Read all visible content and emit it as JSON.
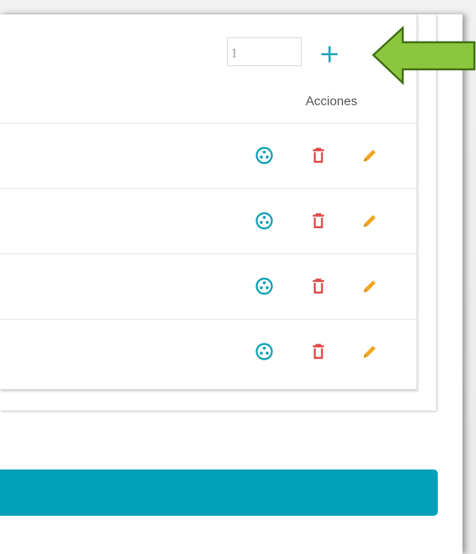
{
  "table": {
    "qty_value": "1",
    "actions_header": "Acciones",
    "row_count": 4
  },
  "icons": {
    "add": "plus-icon",
    "view": "circle-dots-icon",
    "delete": "trash-icon",
    "edit": "pencil-icon",
    "callout": "arrow-left-icon"
  },
  "colors": {
    "teal": "#12a3b3",
    "delete_red": "#e04646",
    "edit_orange": "#f1a51f",
    "primary_bar": "#00a0b8",
    "arrow_green": "#8cc63f"
  }
}
